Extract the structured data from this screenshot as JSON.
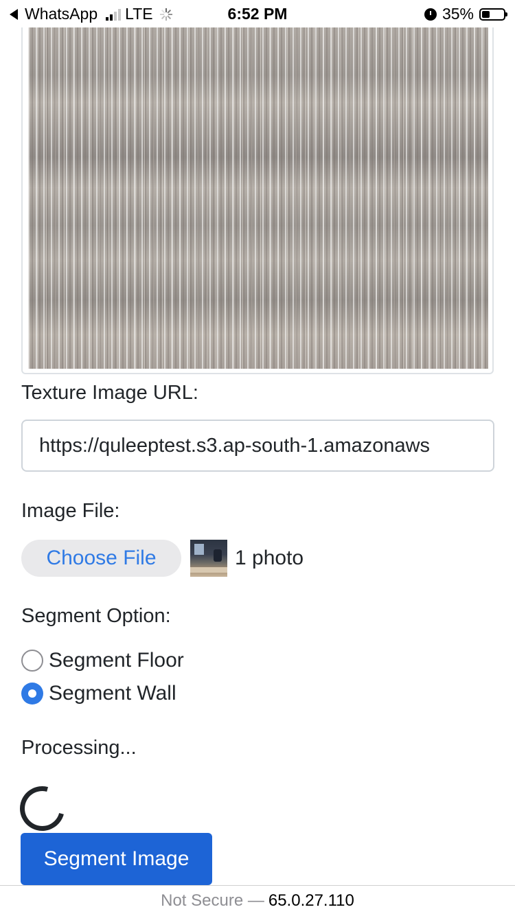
{
  "status_bar": {
    "back_app": "WhatsApp",
    "network": "LTE",
    "time": "6:52 PM",
    "battery_percent": "35%",
    "battery_level": 0.35,
    "icons": [
      "back-arrow-icon",
      "signal-icon",
      "loading-icon",
      "alarm-icon",
      "battery-icon"
    ]
  },
  "form": {
    "texture_label": "Texture Image URL:",
    "texture_url_value": "https://quleeptest.s3.ap-south-1.amazonaws",
    "image_file_label": "Image File:",
    "choose_file_label": "Choose File",
    "file_name": "1 photo",
    "segment_option_label": "Segment Option:",
    "options": [
      {
        "label": "Segment Floor",
        "checked": false
      },
      {
        "label": "Segment Wall",
        "checked": true
      }
    ],
    "processing_text": "Processing...",
    "submit_label": "Segment Image"
  },
  "bottom_bar": {
    "security": "Not Secure —",
    "host": "65.0.27.110"
  },
  "colors": {
    "accent": "#2f7ae5",
    "button": "#1d64d6",
    "text": "#212529"
  }
}
